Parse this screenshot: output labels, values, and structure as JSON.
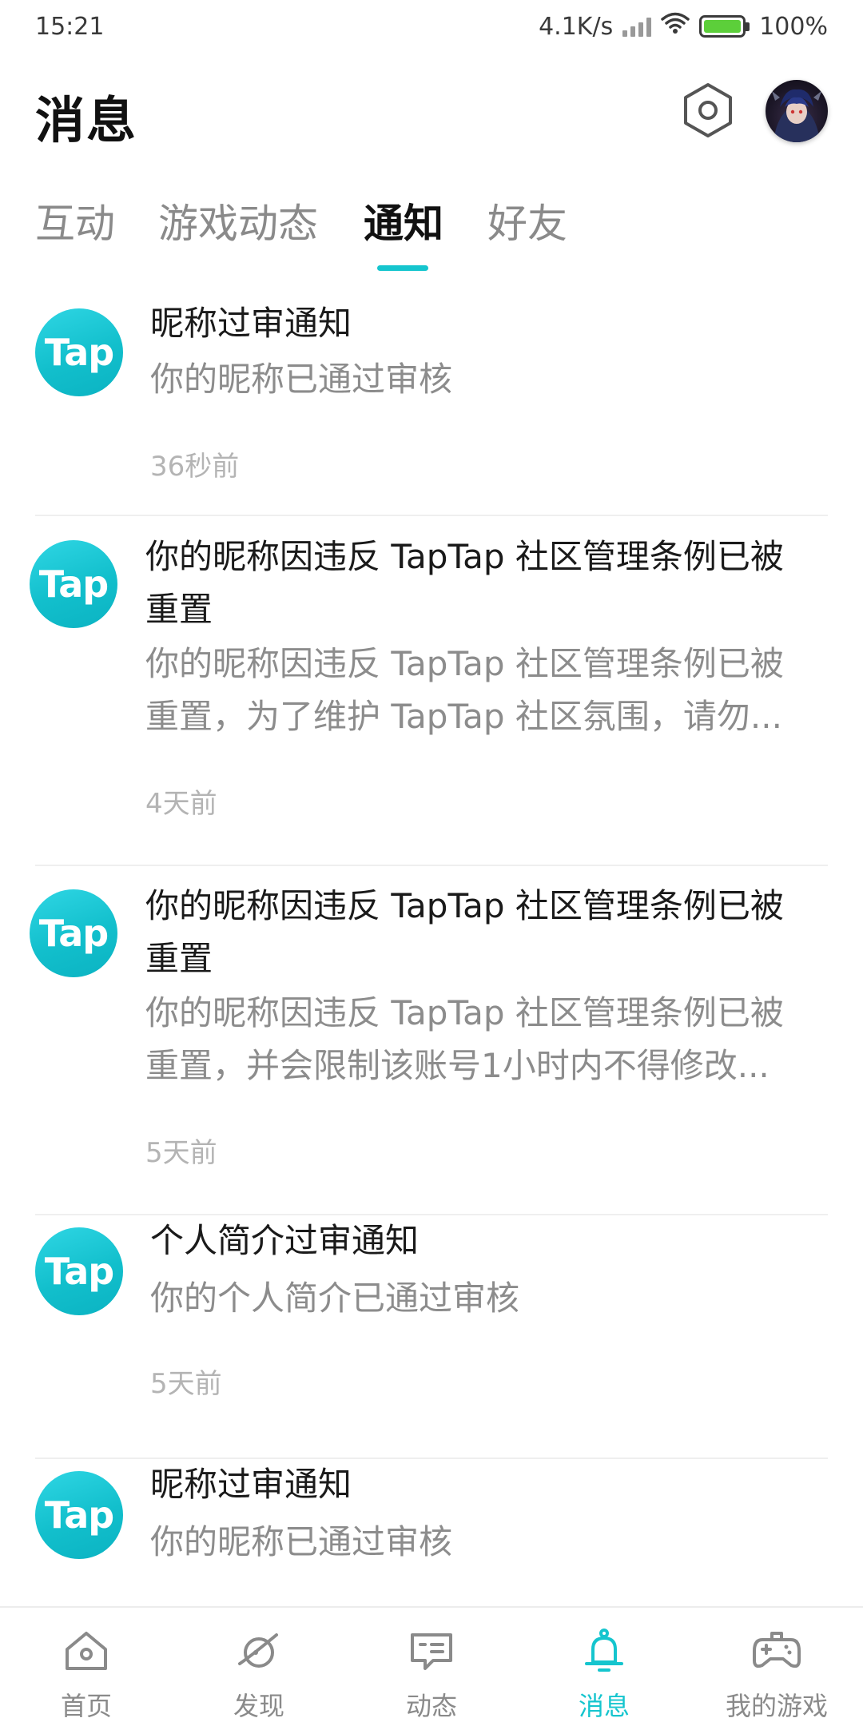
{
  "status_bar": {
    "time": "15:21",
    "network_speed": "4.1K/s",
    "battery_level": "100%"
  },
  "header": {
    "title": "消息",
    "settings_icon": "settings-hexagon-icon",
    "avatar": "user-avatar"
  },
  "tabs": [
    {
      "label": "互动",
      "active": false
    },
    {
      "label": "游戏动态",
      "active": false
    },
    {
      "label": "通知",
      "active": true
    },
    {
      "label": "好友",
      "active": false
    }
  ],
  "accent_color": "#15c5ce",
  "logo_text": "Tap",
  "notifications": [
    {
      "title": "昵称过审通知",
      "body": "你的昵称已通过审核",
      "time": "36秒前"
    },
    {
      "title_line1": "你的昵称因违反 TapTap 社区管理条例已被",
      "title_line2": "重置",
      "body_line1": "你的昵称因违反 TapTap 社区管理条例已被",
      "body_line2": "重置，为了维护 TapTap 社区氛围，请勿...",
      "time": "4天前"
    },
    {
      "title_line1": "你的昵称因违反 TapTap 社区管理条例已被",
      "title_line2": "重置",
      "body_line1": "你的昵称因违反 TapTap 社区管理条例已被",
      "body_line2": "重置，并会限制该账号1小时内不得修改...",
      "time": "5天前"
    },
    {
      "title": "个人简介过审通知",
      "body": "你的个人简介已通过审核",
      "time": "5天前"
    },
    {
      "title": "昵称过审通知",
      "body": "你的昵称已通过审核"
    }
  ],
  "bottom_nav": [
    {
      "label": "首页",
      "icon": "home-icon",
      "active": false
    },
    {
      "label": "发现",
      "icon": "planet-icon",
      "active": false
    },
    {
      "label": "动态",
      "icon": "message-square-icon",
      "active": false
    },
    {
      "label": "消息",
      "icon": "bell-icon",
      "active": true
    },
    {
      "label": "我的游戏",
      "icon": "gamepad-icon",
      "active": false
    }
  ]
}
